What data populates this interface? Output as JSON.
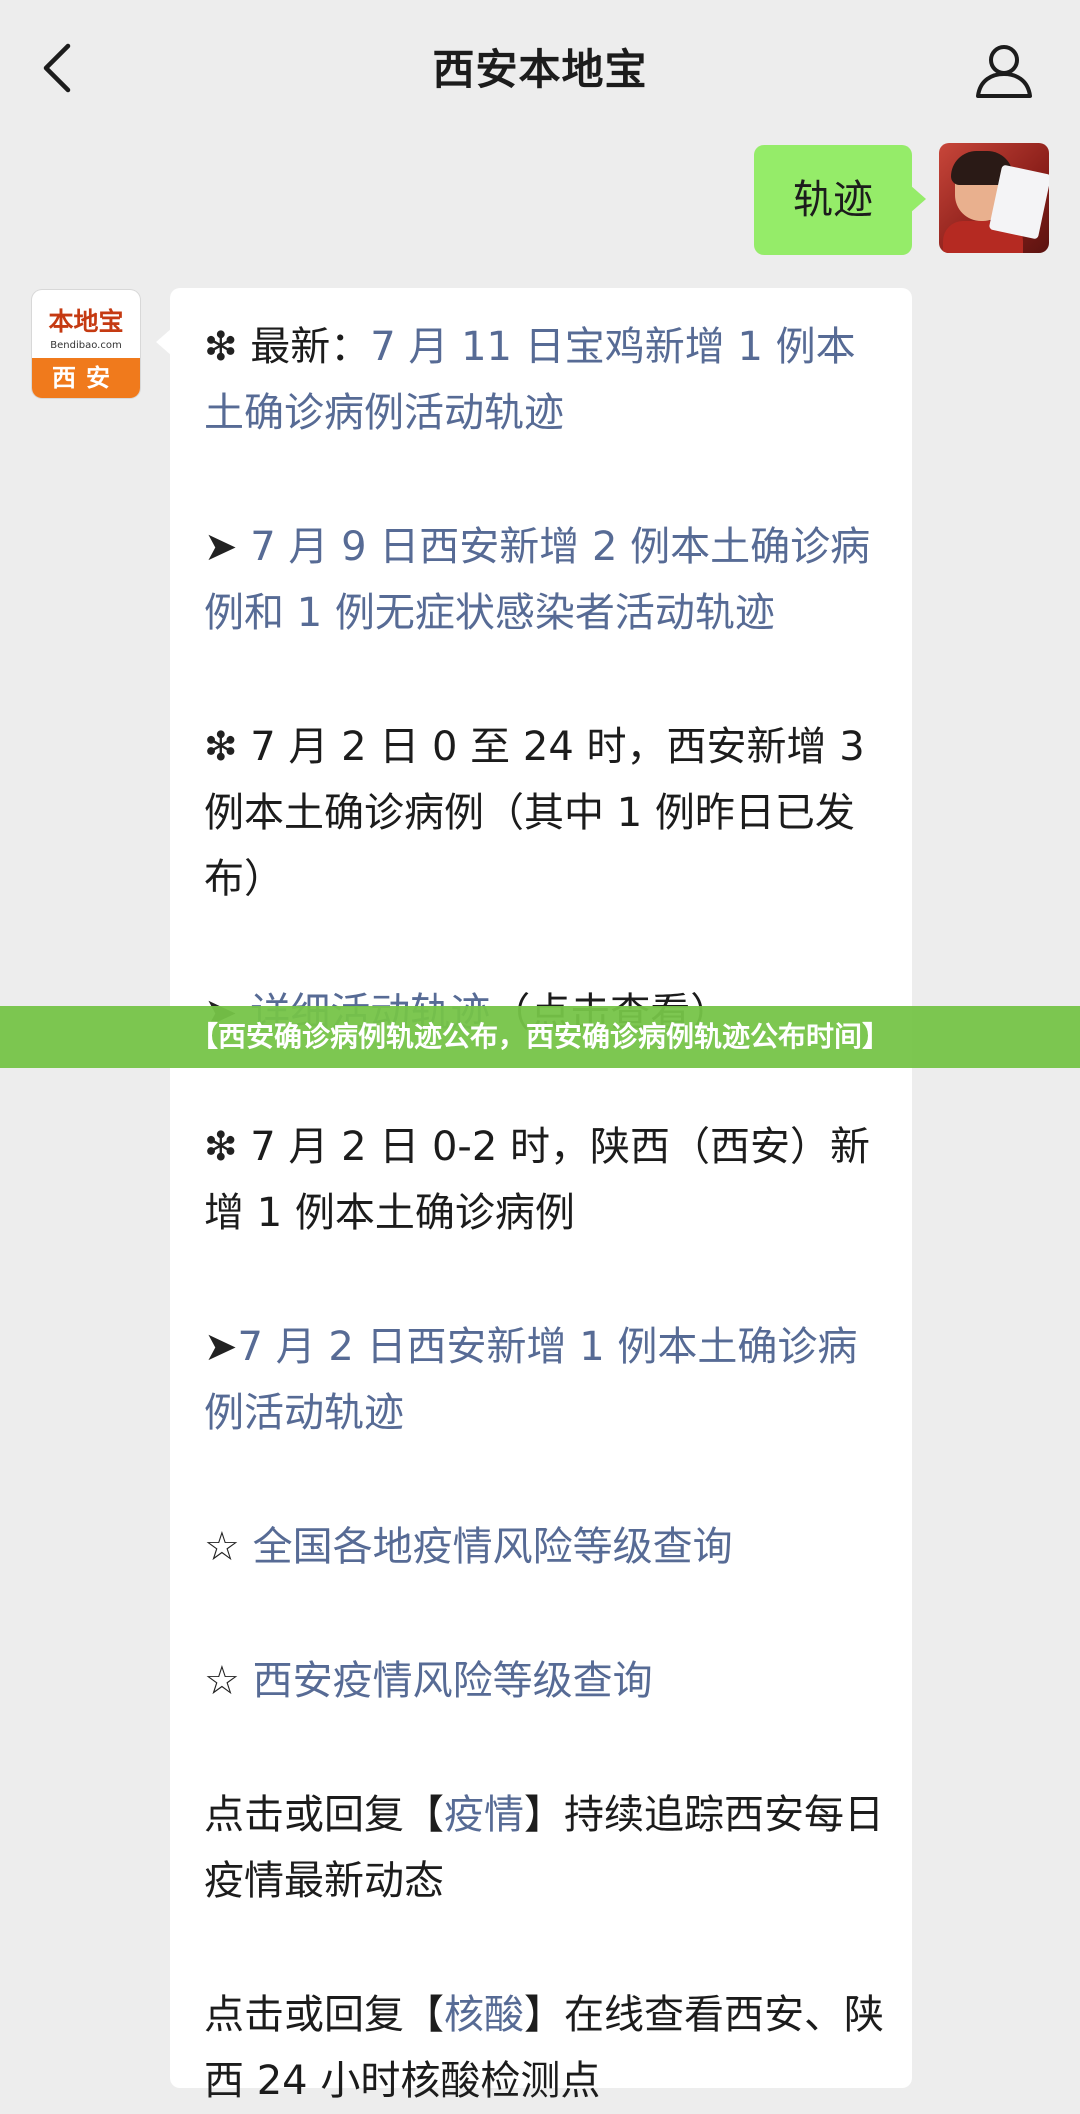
{
  "header": {
    "title": "西安本地宝"
  },
  "outgoing_message": {
    "text": "轨迹"
  },
  "sender_avatar": {
    "brand": "本地宝",
    "domain": "Bendibao.com",
    "city": "西安"
  },
  "message": {
    "items": [
      {
        "marker": "❇",
        "prefix": " 最新：",
        "link": "7 月 11 日宝鸡新增 1 例本土确诊病例活动轨迹",
        "suffix": ""
      },
      {
        "marker": "➤",
        "prefix": " ",
        "link": "7 月 9 日西安新增 2 例本土确诊病例和 1 例无症状感染者活动轨迹",
        "suffix": ""
      },
      {
        "marker": "❇",
        "prefix": " 7 月 2 日 0 至 24 时，西安新增 3 例本土确诊病例（其中 1 例昨日已发布）",
        "link": "",
        "suffix": ""
      },
      {
        "marker": "➤",
        "prefix": " ",
        "link": "详细活动轨迹",
        "suffix": "（点击查看）"
      },
      {
        "marker": "❇",
        "prefix": " 7 月 2 日 0-2 时，陕西（西安）新增 1 例本土确诊病例",
        "link": "",
        "suffix": ""
      },
      {
        "marker": "➤",
        "prefix": "",
        "link": "7 月 2 日西安新增 1 例本土确诊病例活动轨迹",
        "suffix": ""
      },
      {
        "marker": "☆",
        "prefix": "  ",
        "link": "全国各地疫情风险等级查询",
        "suffix": ""
      },
      {
        "marker": "☆",
        "prefix": "  ",
        "link": "西安疫情风险等级查询",
        "suffix": ""
      },
      {
        "marker": "",
        "prefix": "点击或回复【",
        "link": "疫情",
        "suffix": "】持续追踪西安每日疫情最新动态"
      },
      {
        "marker": "",
        "prefix": "点击或回复【",
        "link": "核酸",
        "suffix": "】在线查看西安、陕西 24 小时核酸检测点"
      }
    ]
  },
  "banner": {
    "text": "【西安确诊病例轨迹公布，西安确诊病例轨迹公布时间】"
  },
  "colors": {
    "link": "#576b95",
    "outgoing_bubble": "#95ec69",
    "banner": "#76c448",
    "background": "#ededed"
  }
}
